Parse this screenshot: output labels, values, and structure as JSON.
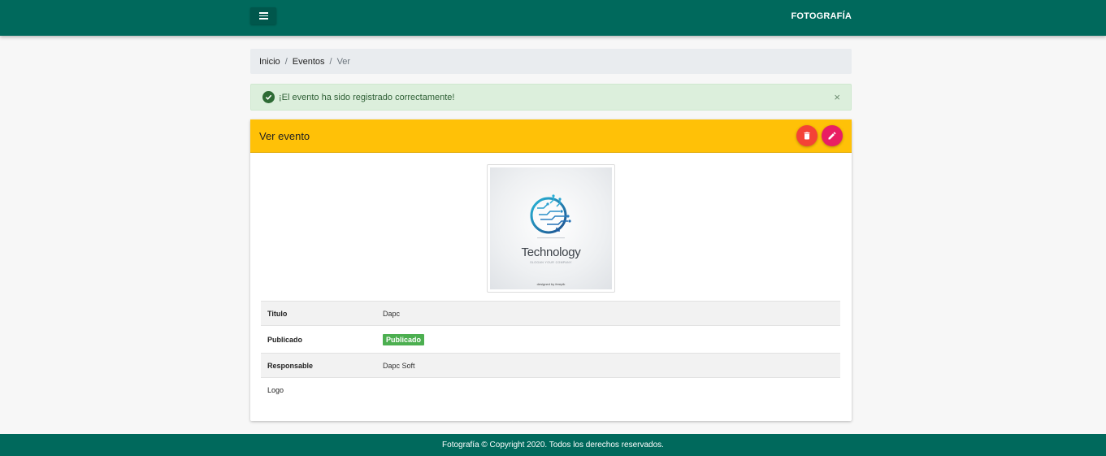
{
  "navbar": {
    "brand": "FOTOGRAFÍA",
    "menu_icon": "hamburger-menu-icon",
    "background": "#00695c"
  },
  "breadcrumb": {
    "items": [
      "Inicio",
      "Eventos"
    ],
    "separator": "/",
    "active": "Ver"
  },
  "alert": {
    "message": "¡El evento ha sido registrado correctamente!",
    "close": "×",
    "icon": "check-circle-icon"
  },
  "card": {
    "title": "Ver evento",
    "header_color": "#ffc107",
    "delete_icon": "trash-icon",
    "edit_icon": "pencil-icon",
    "logo": {
      "title": "Technology",
      "slogan": "SLOGAN YOUR COMPANY",
      "credit": "designed by freepik"
    },
    "rows": [
      {
        "label": "Titulo",
        "value": "Dapc"
      },
      {
        "label": "Publicado",
        "value": "Publicado"
      },
      {
        "label": "Responsable",
        "value": "Dapc Soft"
      },
      {
        "label": "Logo",
        "value": ""
      }
    ],
    "badge_color": "#4caf50"
  },
  "footer": {
    "text": "Fotografía © Copyright 2020. Todos los derechos reservados."
  }
}
